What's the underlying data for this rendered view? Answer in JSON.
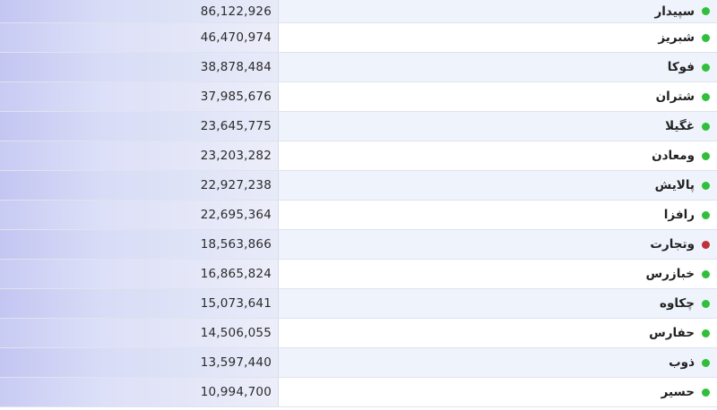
{
  "colors": {
    "up": "#2fbf3a",
    "down": "#c1313c"
  },
  "rows": [
    {
      "name": "سپیدار",
      "value": "86,122,926",
      "status": "up"
    },
    {
      "name": "شبریز",
      "value": "46,470,974",
      "status": "up"
    },
    {
      "name": "فوکا",
      "value": "38,878,484",
      "status": "up"
    },
    {
      "name": "شتران",
      "value": "37,985,676",
      "status": "up"
    },
    {
      "name": "غگیلا",
      "value": "23,645,775",
      "status": "up"
    },
    {
      "name": "ومعادن",
      "value": "23,203,282",
      "status": "up"
    },
    {
      "name": "پالایش",
      "value": "22,927,238",
      "status": "up"
    },
    {
      "name": "رافزا",
      "value": "22,695,364",
      "status": "up"
    },
    {
      "name": "وتجارت",
      "value": "18,563,866",
      "status": "down"
    },
    {
      "name": "خبازرس",
      "value": "16,865,824",
      "status": "up"
    },
    {
      "name": "چکاوه",
      "value": "15,073,641",
      "status": "up"
    },
    {
      "name": "حفارس",
      "value": "14,506,055",
      "status": "up"
    },
    {
      "name": "ذوب",
      "value": "13,597,440",
      "status": "up"
    },
    {
      "name": "حسیر",
      "value": "10,994,700",
      "status": "up"
    }
  ]
}
